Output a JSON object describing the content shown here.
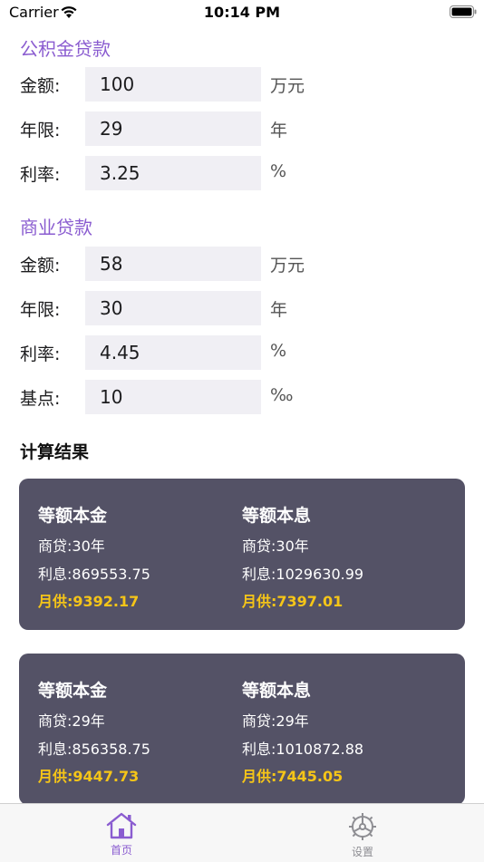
{
  "status_bar": {
    "carrier": "Carrier",
    "time": "10:14 PM"
  },
  "provident_fund": {
    "title": "公积金贷款",
    "rows": [
      {
        "label": "金额:",
        "value": "100",
        "unit": "万元"
      },
      {
        "label": "年限:",
        "value": "29",
        "unit": "年"
      },
      {
        "label": "利率:",
        "value": "3.25",
        "unit": "%"
      }
    ]
  },
  "commercial": {
    "title": "商业贷款",
    "rows": [
      {
        "label": "金额:",
        "value": "58",
        "unit": "万元"
      },
      {
        "label": "年限:",
        "value": "30",
        "unit": "年"
      },
      {
        "label": "利率:",
        "value": "4.45",
        "unit": "%"
      },
      {
        "label": "基点:",
        "value": "10",
        "unit": "‰"
      }
    ]
  },
  "results": {
    "heading": "计算结果",
    "cards": [
      {
        "left": {
          "title": "等额本金",
          "term": "商贷:30年",
          "interest": "利息:869553.75",
          "monthly": "月供:9392.17"
        },
        "right": {
          "title": "等额本息",
          "term": "商贷:30年",
          "interest": "利息:1029630.99",
          "monthly": "月供:7397.01"
        }
      },
      {
        "left": {
          "title": "等额本金",
          "term": "商贷:29年",
          "interest": "利息:856358.75",
          "monthly": "月供:9447.73"
        },
        "right": {
          "title": "等额本息",
          "term": "商贷:29年",
          "interest": "利息:1010872.88",
          "monthly": "月供:7445.05"
        }
      }
    ]
  },
  "tabbar": {
    "home_label": "首页",
    "settings_label": "设置",
    "home_icon": "house-icon",
    "settings_icon": "gear-icon"
  },
  "colors": {
    "accent": "#8a5cd0",
    "card_bg": "#545266",
    "monthly_highlight": "#f5c518",
    "field_bg": "#f0eff4"
  }
}
